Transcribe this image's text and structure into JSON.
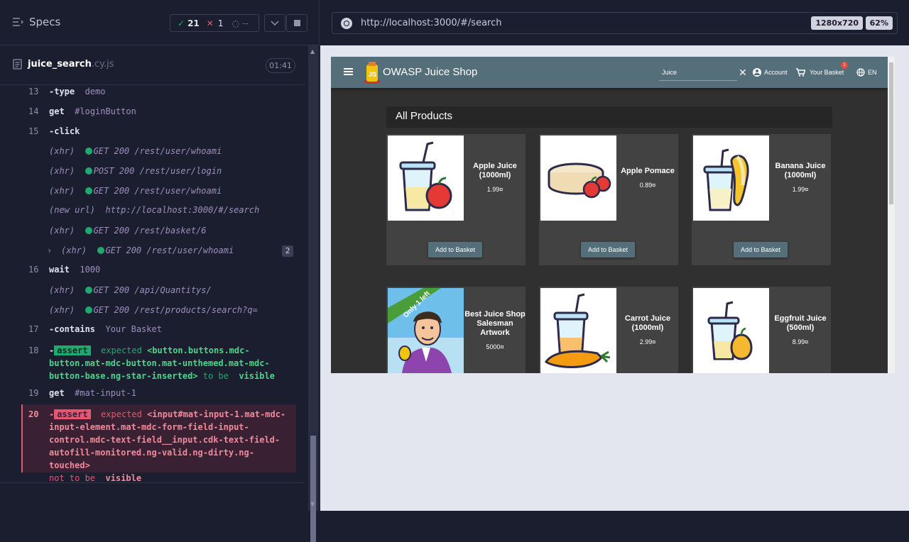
{
  "runner": {
    "specs_label": "Specs",
    "passed": "21",
    "failed": "1",
    "pending": "--",
    "spec_name": "juice_search",
    "spec_ext": ".cy.js",
    "timer": "01:41",
    "commands": [
      {
        "num": "13",
        "name": "-type",
        "arg": "demo"
      },
      {
        "num": "14",
        "name": "get",
        "arg": "#loginButton"
      },
      {
        "num": "15",
        "name": "-click",
        "arg": ""
      },
      {
        "num": "",
        "name": "(xhr)",
        "arg": "GET 200 /rest/user/whoami"
      },
      {
        "num": "",
        "name": "(xhr)",
        "arg": "POST 200 /rest/user/login"
      },
      {
        "num": "",
        "name": "(xhr)",
        "arg": "GET 200 /rest/user/whoami"
      },
      {
        "num": "",
        "name": "(new url)",
        "arg": "http://localhost:3000/#/search"
      },
      {
        "num": "",
        "name": "(xhr)",
        "arg": "GET 200 /rest/basket/6"
      },
      {
        "num": "",
        "name": "(xhr)",
        "arg": "GET 200 /rest/user/whoami",
        "count": "2"
      },
      {
        "num": "16",
        "name": "wait",
        "arg": "1000"
      },
      {
        "num": "",
        "name": "(xhr)",
        "arg": "GET 200 /api/Quantitys/"
      },
      {
        "num": "",
        "name": "(xhr)",
        "arg": "GET 200 /rest/products/search?q="
      },
      {
        "num": "17",
        "name": "-contains",
        "arg": "Your Basket"
      },
      {
        "num": "18",
        "name": "-assert",
        "arg": ""
      },
      {
        "num": "19",
        "name": "get",
        "arg": "#mat-input-1"
      },
      {
        "num": "20",
        "name": "-assert",
        "arg": ""
      }
    ],
    "assert18": {
      "label": "assert",
      "expected": "expected",
      "selector_l1": "<button.buttons.mdc-",
      "selector_l2": "button.mat-mdc-button.mat-unthemed.mat-mdc-",
      "selector_l3": "button-base.ng-star-inserted>",
      "to_be": "to be",
      "state": "visible"
    },
    "assert20": {
      "label": "assert",
      "expected": "expected",
      "selector_l1": "<input#mat-input-1.mat-mdc-",
      "selector_l2": "input-element.mat-mdc-form-field-input-",
      "selector_l3": "control.mdc-text-field__input.cdk-text-field-",
      "selector_l4": "autofill-monitored.ng-valid.ng-dirty.ng-touched>",
      "not_to_be": "not to be",
      "state": "visible"
    }
  },
  "browser": {
    "url": "http://localhost:3000/#/search",
    "viewport": "1280x720",
    "zoom": "62%"
  },
  "app": {
    "title": "OWASP Juice Shop",
    "search_value": "Juice",
    "account_label": "Account",
    "basket_label": "Your Basket",
    "basket_count": "1",
    "lang_label": "EN",
    "section_title": "All Products",
    "add_label": "Add to Basket",
    "products": [
      {
        "name": "Apple Juice (1000ml)",
        "price": "1.99¤"
      },
      {
        "name": "Apple Pomace",
        "price": "0.89¤"
      },
      {
        "name": "Banana Juice (1000ml)",
        "price": "1.99¤"
      },
      {
        "name": "Best Juice Shop Salesman Artwork",
        "price": "5000¤",
        "ribbon": "Only 1 left"
      },
      {
        "name": "Carrot Juice (1000ml)",
        "price": "2.99¤"
      },
      {
        "name": "Eggfruit Juice (500ml)",
        "price": "8.99¤"
      }
    ]
  }
}
